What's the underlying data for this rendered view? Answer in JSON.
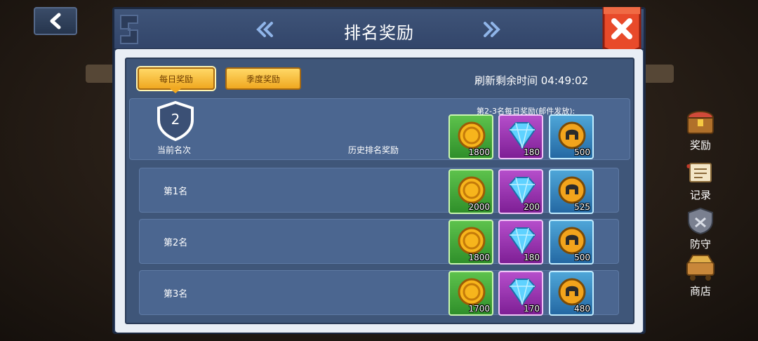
{
  "header": {
    "title": "排名奖励"
  },
  "tabs": {
    "daily": "每日奖励",
    "season": "季度奖励"
  },
  "refresh": {
    "text": "刷新剩余时间 04:49:02"
  },
  "current": {
    "rank": "2",
    "rank_label": "当前名次",
    "history_label": "历史排名奖励",
    "mail_note": "第2-3名每日奖励(邮件发放):",
    "rewards": [
      "1800",
      "180",
      "500"
    ]
  },
  "rows": [
    {
      "label": "第1名",
      "rewards": [
        "2000",
        "200",
        "525"
      ]
    },
    {
      "label": "第2名",
      "rewards": [
        "1800",
        "180",
        "500"
      ]
    },
    {
      "label": "第3名",
      "rewards": [
        "1700",
        "170",
        "480"
      ]
    }
  ],
  "side_menu": [
    {
      "label": "奖励",
      "icon": "chest-icon"
    },
    {
      "label": "记录",
      "icon": "scroll-icon"
    },
    {
      "label": "防守",
      "icon": "shield-icon"
    },
    {
      "label": "商店",
      "icon": "cart-icon"
    }
  ],
  "colors": {
    "panel": "#3b5075",
    "row": "#4b6690",
    "close": "#e84a2a",
    "tab": "#f0a820"
  }
}
